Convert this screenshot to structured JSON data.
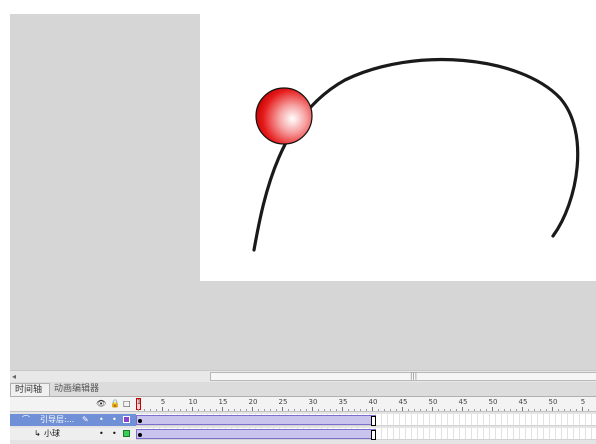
{
  "timeline": {
    "tabs": [
      {
        "label": "时间轴"
      },
      {
        "label": "动画编辑器"
      }
    ],
    "ruler_labels": [
      "1",
      "5",
      "10",
      "15",
      "20",
      "25",
      "30",
      "35",
      "40",
      "45",
      "50",
      "45",
      "50",
      "45",
      "50",
      "5",
      "80"
    ],
    "layers": [
      {
        "name": "引导层:...",
        "color": "#8c3fd0",
        "frames": 40
      },
      {
        "name": "小球",
        "color": "#36d056",
        "frames": 40
      }
    ],
    "current_frame": 1
  },
  "colors": {
    "workspace": "#d6d6d6",
    "stage": "#ffffff",
    "ball": "#e81a1a",
    "guide_path": "#1a1a1a",
    "selected_layer": "#6f8fd6"
  },
  "icons": {
    "eye": "eye-icon",
    "lock": "lock-icon",
    "outline": "outline-icon",
    "guide_layer": "guide-layer-icon",
    "normal_layer": "layer-icon",
    "pencil": "pencil-icon"
  }
}
